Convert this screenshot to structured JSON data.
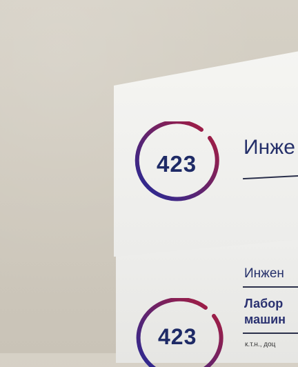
{
  "top_sign": {
    "room_number": "423",
    "title": "Инже"
  },
  "bottom_sign": {
    "room_number": "423",
    "line1": "Инжен",
    "line2a": "Лабор",
    "line2b": "машин",
    "line3": "к.т.н., доц"
  },
  "colors": {
    "ring_start": "#b01c3a",
    "ring_end": "#1f2a9a",
    "text": "#25306a"
  }
}
